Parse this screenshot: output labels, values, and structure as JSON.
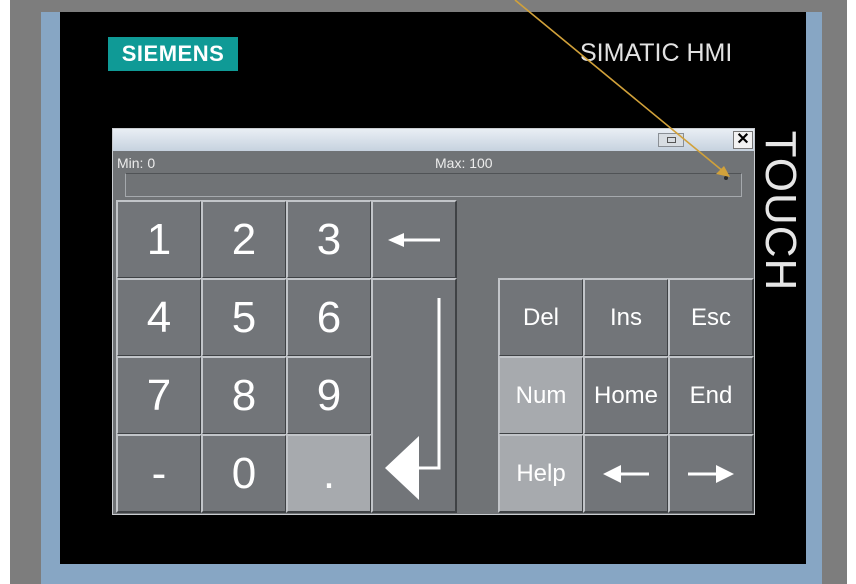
{
  "device": {
    "brand_logo": "SIEMENS",
    "product_name": "SIMATIC HMI",
    "side_label": "TOUCH"
  },
  "dialog": {
    "close_label": "✕",
    "min_label": "Min: 0",
    "max_label": "Max: 100",
    "value": ""
  },
  "keypad": {
    "digits": [
      "1",
      "2",
      "3",
      "4",
      "5",
      "6",
      "7",
      "8",
      "9",
      "-",
      "0",
      "."
    ],
    "keys": {
      "del": "Del",
      "ins": "Ins",
      "esc": "Esc",
      "num": "Num",
      "home": "Home",
      "end": "End",
      "help": "Help"
    },
    "icons": {
      "backspace": "left-arrow-icon",
      "enter": "enter-arrow-icon",
      "cursor_left": "left-arrow-icon",
      "cursor_right": "right-arrow-icon"
    }
  },
  "colors": {
    "logo_bg": "#0f9a96",
    "key_bg": "#727579",
    "key_active_bg": "#a7aaae",
    "annotation_arrow": "#d1a13a"
  }
}
